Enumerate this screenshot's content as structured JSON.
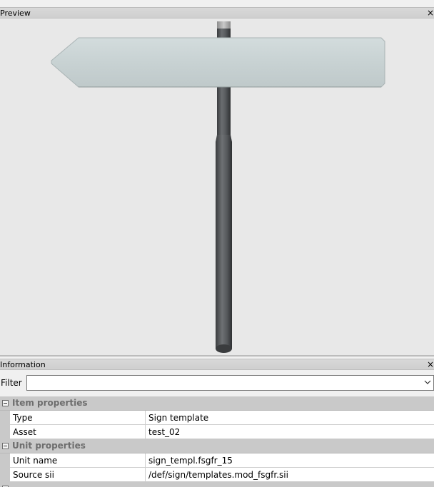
{
  "preview": {
    "title": "Preview"
  },
  "information": {
    "title": "Information",
    "filter": {
      "label": "Filter",
      "value": ""
    },
    "categories": [
      {
        "label": "Item properties",
        "properties": [
          {
            "name": "Type",
            "value": "Sign template"
          },
          {
            "name": "Asset",
            "value": "test_02"
          }
        ]
      },
      {
        "label": "Unit properties",
        "properties": [
          {
            "name": "Unit name",
            "value": "sign_templ.fsgfr_15"
          },
          {
            "name": "Source sii",
            "value": "/def/sign/templates.mod_fsgfr.sii"
          }
        ]
      }
    ]
  },
  "icons": {
    "close": "close-icon",
    "collapse": "collapse-minus-icon",
    "dropdown": "chevron-down-icon"
  }
}
